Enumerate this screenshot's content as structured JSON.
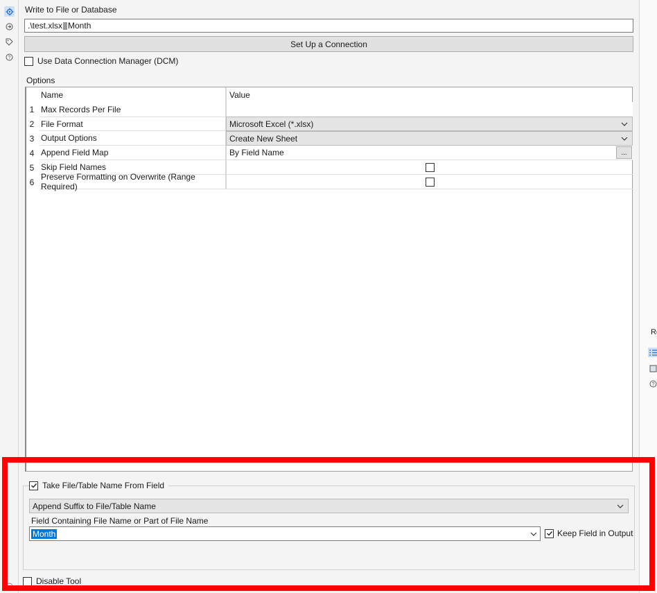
{
  "write_section": {
    "title": "Write to File or Database",
    "path_prefix": ".\\test.xlsx",
    "path_suffix": "Month",
    "setup_button": "Set Up a Connection",
    "dcm_label": "Use Data Connection Manager (DCM)",
    "dcm_checked": false
  },
  "options": {
    "label": "Options",
    "headers": {
      "name": "Name",
      "value": "Value"
    },
    "rows": [
      {
        "num": "1",
        "name": "Max Records Per File",
        "value": ""
      },
      {
        "num": "2",
        "name": "File Format",
        "value": "Microsoft Excel (*.xlsx)"
      },
      {
        "num": "3",
        "name": "Output Options",
        "value": "Create New Sheet"
      },
      {
        "num": "4",
        "name": "Append Field Map",
        "value": "By Field Name",
        "button": "..."
      },
      {
        "num": "5",
        "name": "Skip Field Names",
        "value_checked": false
      },
      {
        "num": "6",
        "name": "Preserve Formatting on Overwrite (Range Required)",
        "value_checked": false
      }
    ]
  },
  "filename_section": {
    "take_label": "Take File/Table Name From Field",
    "take_checked": true,
    "mode_value": "Append Suffix to File/Table Name",
    "field_label": "Field Containing File Name or Part of File Name",
    "field_value": "Month",
    "keep_label": "Keep Field in Output",
    "keep_checked": true
  },
  "disable_label": "Disable Tool",
  "right_panel": {
    "label": "Re"
  },
  "colors": {
    "highlight": "#ff0000",
    "selection": "#0078d7",
    "active_icon_bg": "#cfe0f4"
  },
  "icons": [
    "gear-icon",
    "connections-icon",
    "tag-icon",
    "help-icon",
    "list-icon",
    "panel-icon",
    "help-icon"
  ]
}
